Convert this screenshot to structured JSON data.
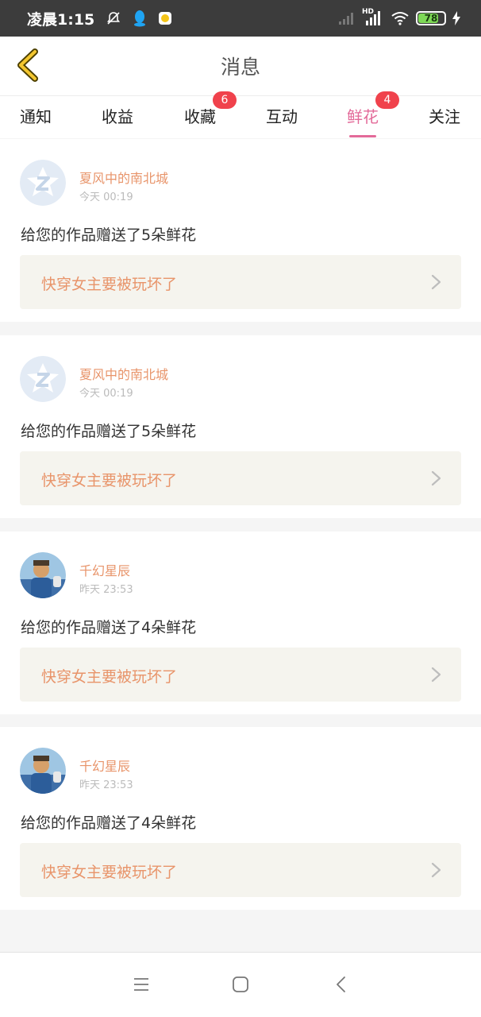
{
  "status_bar": {
    "time": "凌晨1:15",
    "network": "HD",
    "battery": "78",
    "battery_level": 0.78,
    "icons": [
      "mute-bell-icon",
      "qq-icon",
      "app-notification-icon",
      "cellular-signal-icon",
      "hd-signal-icon",
      "wifi-icon",
      "battery-icon",
      "charging-icon"
    ]
  },
  "header": {
    "title": "消息",
    "back_icon": "back-chevron-icon"
  },
  "tabs": [
    {
      "label": "通知",
      "badge": "",
      "active": false
    },
    {
      "label": "收益",
      "badge": "",
      "active": false
    },
    {
      "label": "收藏",
      "badge": "6",
      "active": false
    },
    {
      "label": "互动",
      "badge": "",
      "active": false
    },
    {
      "label": "鲜花",
      "badge": "4",
      "active": true
    },
    {
      "label": "关注",
      "badge": "",
      "active": false
    }
  ],
  "messages": [
    {
      "user": "夏风中的南北城",
      "time": "今天 00:19",
      "text": "给您的作品赠送了5朵鲜花",
      "work": "快穿女主要被玩坏了",
      "avatar": "default-avatar-icon"
    },
    {
      "user": "夏风中的南北城",
      "time": "今天 00:19",
      "text": "给您的作品赠送了5朵鲜花",
      "work": "快穿女主要被玩坏了",
      "avatar": "default-avatar-icon"
    },
    {
      "user": "千幻星辰",
      "time": "昨天 23:53",
      "text": "给您的作品赠送了4朵鲜花",
      "work": "快穿女主要被玩坏了",
      "avatar": "user-photo-avatar"
    },
    {
      "user": "千幻星辰",
      "time": "昨天 23:53",
      "text": "给您的作品赠送了4朵鲜花",
      "work": "快穿女主要被玩坏了",
      "avatar": "user-photo-avatar"
    }
  ],
  "system_nav": [
    "menu-icon",
    "home-icon",
    "back-icon"
  ],
  "colors": {
    "accent": "#e36a99",
    "badge": "#f0424c",
    "username": "#e8946a",
    "work_box": "#f5f4ee",
    "status_bar": "#3c3c3c"
  }
}
